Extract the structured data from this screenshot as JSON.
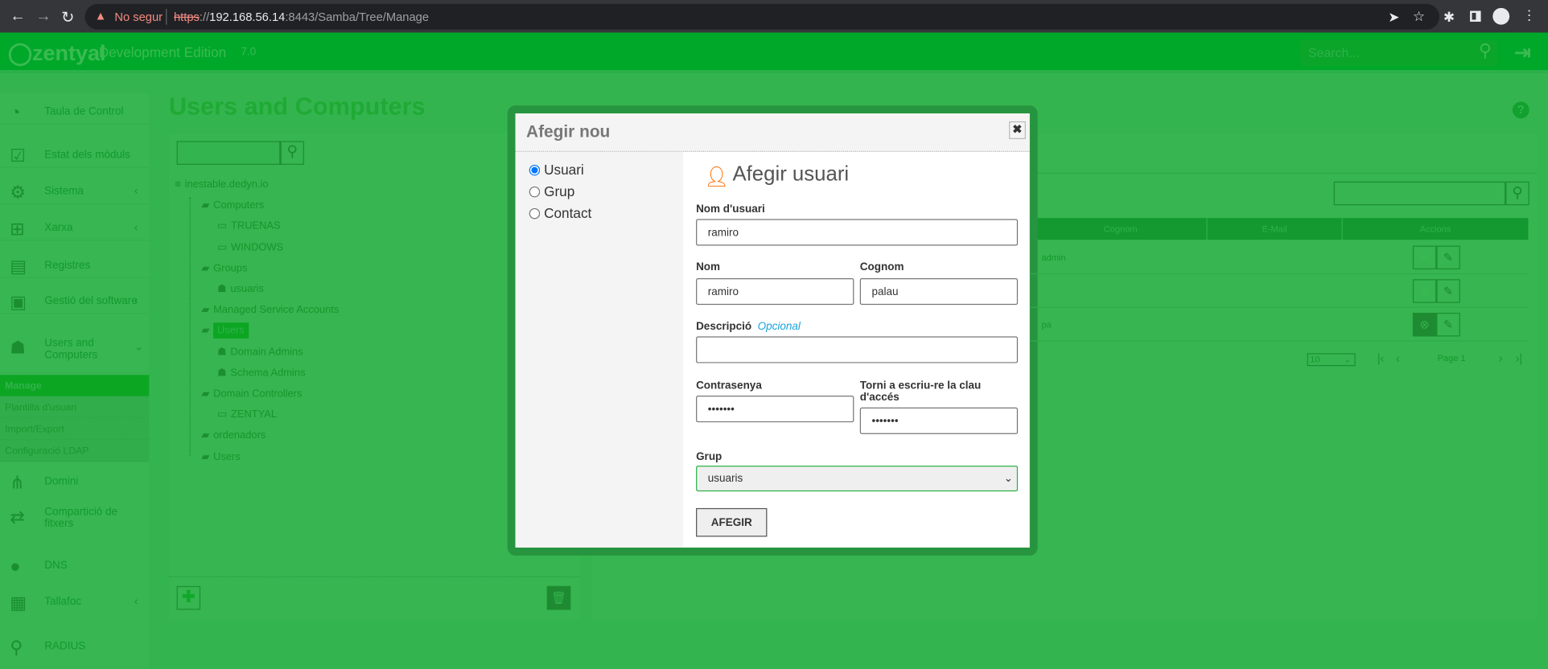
{
  "browser": {
    "security": "No segur",
    "url_scheme": "https",
    "url_host": "192.168.56.14",
    "url_rest": ":8443/Samba/Tree/Manage"
  },
  "header": {
    "logo": "zentyal",
    "edition": "Development Edition",
    "version": "7.0",
    "search_placeholder": "Search..."
  },
  "sidebar": {
    "items": [
      {
        "label": "Taula de Control",
        "icon": "dashboard-icon"
      },
      {
        "label": "Estat dels mòduls",
        "icon": "checklist-icon"
      },
      {
        "label": "Sistema",
        "icon": "gear-icon"
      },
      {
        "label": "Xarxa",
        "icon": "network-icon"
      },
      {
        "label": "Registres",
        "icon": "clipboard-icon"
      },
      {
        "label": "Gestió del software",
        "icon": "package-icon"
      },
      {
        "label": "Users and Computers",
        "icon": "users-icon"
      }
    ],
    "subitems": [
      "Manage",
      "Plantilla d'usuari",
      "Import/Export",
      "Configuració LDAP"
    ],
    "items2": [
      {
        "label": "Domini",
        "icon": "tree-icon"
      },
      {
        "label": "Compartició de fitxers",
        "icon": "file-share-icon"
      },
      {
        "label": "DNS",
        "icon": "dns-icon"
      },
      {
        "label": "Tallafoc",
        "icon": "firewall-icon"
      },
      {
        "label": "RADIUS",
        "icon": "antenna-icon"
      }
    ]
  },
  "page": {
    "title": "Users and Computers"
  },
  "tree": [
    {
      "label": "inestable.dedyn.io",
      "icon": "server-icon",
      "level": 0
    },
    {
      "label": "Computers",
      "icon": "folder-icon",
      "level": 1
    },
    {
      "label": "TRUENAS",
      "icon": "computer-icon",
      "level": 2
    },
    {
      "label": "WINDOWS",
      "icon": "computer-icon",
      "level": 2
    },
    {
      "label": "Groups",
      "icon": "folder-icon",
      "level": 1
    },
    {
      "label": "usuaris",
      "icon": "group-icon",
      "level": 2
    },
    {
      "label": "Managed Service Accounts",
      "icon": "folder-icon",
      "level": 1
    },
    {
      "label": "Users",
      "icon": "folder-icon",
      "level": 1,
      "selected": true
    },
    {
      "label": "Domain Admins",
      "icon": "group-icon",
      "level": 2
    },
    {
      "label": "Schema Admins",
      "icon": "group-icon",
      "level": 2
    },
    {
      "label": "Domain Controllers",
      "icon": "folder-icon",
      "level": 1
    },
    {
      "label": "ZENTYAL",
      "icon": "computer-icon",
      "level": 2
    },
    {
      "label": "ordenadors",
      "icon": "folder-icon",
      "level": 1
    },
    {
      "label": "Users",
      "icon": "folder-icon",
      "level": 1
    }
  ],
  "table": {
    "columns": [
      "Cognom",
      "E-Mail",
      "Accions"
    ],
    "rows": [
      {
        "cognom": "admin",
        "email": ""
      },
      {
        "cognom": "",
        "email": ""
      },
      {
        "cognom": "pa",
        "email": ""
      }
    ],
    "page_size": "10",
    "page": "Page 1"
  },
  "modal": {
    "title": "Afegir nou",
    "close": "✖",
    "types": [
      "Usuari",
      "Grup",
      "Contact"
    ],
    "selected_type": "Usuari",
    "heading": "Afegir usuari",
    "fields": {
      "username_label": "Nom d'usuari",
      "username": "ramiro",
      "name_label": "Nom",
      "name": "ramiro",
      "surname_label": "Cognom",
      "surname": "palau",
      "desc_label": "Descripció",
      "desc_optional": "Opcional",
      "desc": "",
      "password_label": "Contrasenya",
      "password": "•••••••",
      "repassword_label": "Torni a escriu-re la clau d'accés",
      "repassword": "•••••••",
      "group_label": "Grup",
      "group": "usuaris"
    },
    "submit": "AFEGIR"
  },
  "colors": {
    "header": "#00a82a",
    "overlay": "#34b44e",
    "user_icon": "#ff6d00",
    "optional": "#1aa3d9"
  }
}
